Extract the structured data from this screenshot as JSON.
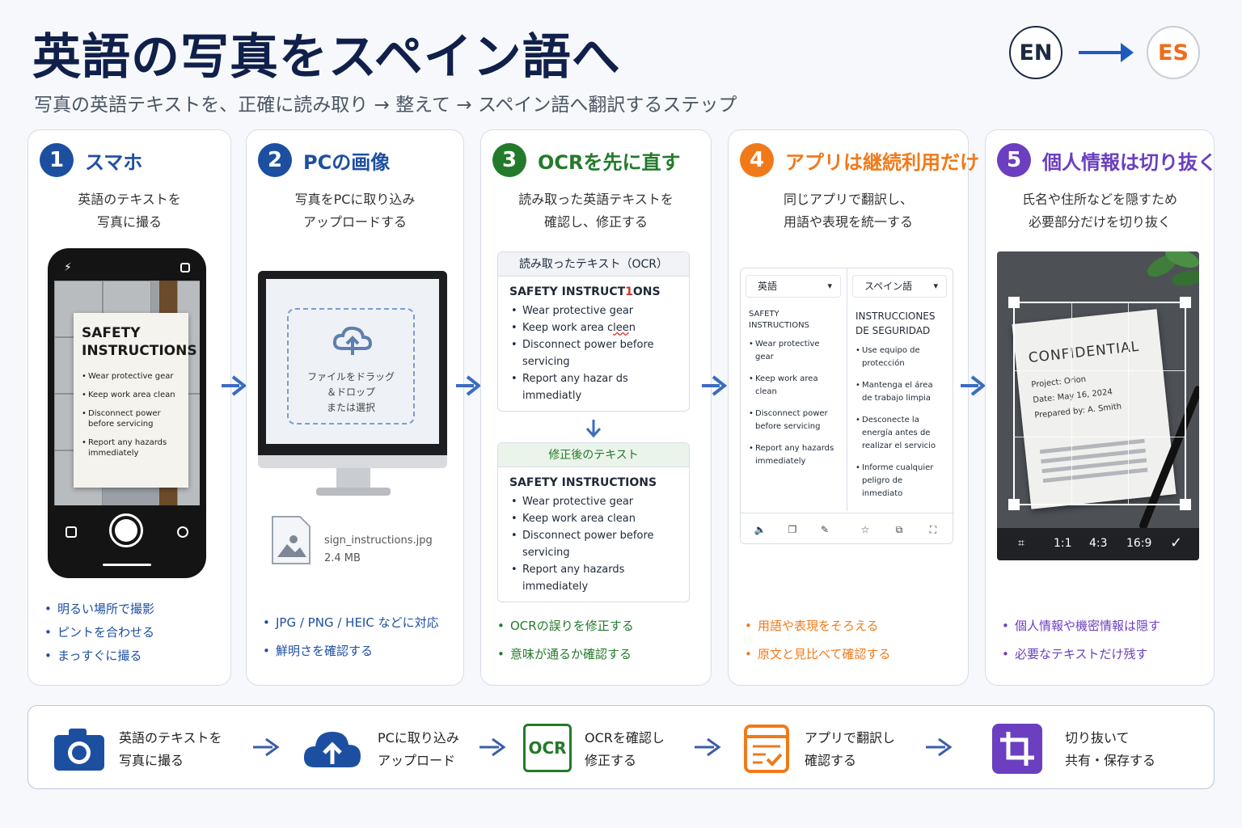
{
  "header": {
    "title": "英語の写真をスペイン語へ",
    "subtitle": "写真の英語テキストを、正確に読み取り → 整えて → スペイン語へ翻訳するステップ",
    "lang_from": "EN",
    "lang_to": "ES"
  },
  "colors": {
    "navy": "#10204a",
    "step1": "#1d4fa0",
    "step2": "#1d4fa0",
    "step3": "#237a2b",
    "step4": "#f07a1a",
    "step5": "#6b3fbf"
  },
  "steps": [
    {
      "num": "1",
      "title": "スマホ",
      "desc": [
        "英語のテキストを",
        "写真に撮る"
      ],
      "bullets": [
        "明るい場所で撮影",
        "ピントを合わせる",
        "まっすぐに撮る"
      ],
      "sign": {
        "title_1": "SAFETY",
        "title_2": "INSTRUCTIONS",
        "items": [
          "Wear protective gear",
          "Keep work area clean",
          "Disconnect power before servicing",
          "Report any hazards immediately"
        ]
      }
    },
    {
      "num": "2",
      "title": "PCの画像",
      "desc": [
        "写真をPCに取り込み",
        "アップロードする"
      ],
      "dropzone": [
        "ファイルをドラッグ",
        "＆ドロップ",
        "または選択"
      ],
      "file_name": "sign_instructions.jpg",
      "file_size": "2.4 MB",
      "bullets": [
        "JPG / PNG / HEIC などに対応",
        "鮮明さを確認する"
      ]
    },
    {
      "num": "3",
      "title": "OCRを先に直す",
      "desc": [
        "読み取った英語テキストを",
        "確認し、修正する"
      ],
      "ocr_raw": {
        "header": "読み取ったテキスト（OCR）",
        "title_a": "SAFETY INSTRUCT",
        "title_err": "1",
        "title_b": "ONS",
        "item1": "Wear protective gear",
        "item2_a": "Keep work area c",
        "item2_err": "lee",
        "item2_b": "n",
        "item3": "Disconnect power before servicing",
        "item4": "Report any hazar ds immediatly"
      },
      "ocr_fixed": {
        "header": "修正後のテキスト",
        "title": "SAFETY INSTRUCTIONS",
        "items": [
          "Wear protective gear",
          "Keep work area clean",
          "Disconnect power before servicing",
          "Report any hazards immediately"
        ]
      },
      "bullets": [
        "OCRの誤りを修正する",
        "意味が通るか確認する"
      ]
    },
    {
      "num": "4",
      "title": "アプリは継続利用だけ",
      "desc": [
        "同じアプリで翻訳し、",
        "用語や表現を統一する"
      ],
      "source_lang": "英語",
      "target_lang": "スペイン語",
      "source_title": "SAFETY INSTRUCTIONS",
      "source_items": [
        "Wear protective gear",
        "Keep work area clean",
        "Disconnect power before servicing",
        "Report any hazards immediately"
      ],
      "target_title_1": "INSTRUCCIONES",
      "target_title_2": "DE SEGURIDAD",
      "target_items": [
        "Use equipo de protección",
        "Mantenga el área de trabajo limpia",
        "Desconecte la energía antes de realizar el servicio",
        "Informe cualquier peligro de inmediato"
      ],
      "bullets": [
        "用語や表現をそろえる",
        "原文と見比べて確認する"
      ]
    },
    {
      "num": "5",
      "title": "個人情報は切り抜く",
      "desc": [
        "氏名や住所などを隠すため",
        "必要部分だけを切り抜く"
      ],
      "paper_title": "CONFIDENTIAL",
      "paper_lines": [
        "Project: Orion",
        "Date: May 16, 2024",
        "Prepared by: A. Smith"
      ],
      "ratios": [
        "1:1",
        "4:3",
        "16:9"
      ],
      "bullets": [
        "個人情報や機密情報は隠す",
        "必要なテキストだけ残す"
      ]
    }
  ],
  "flow": [
    {
      "icon": "camera-icon",
      "lines": [
        "英語のテキストを",
        "写真に撮る"
      ]
    },
    {
      "icon": "upload-cloud-icon",
      "lines": [
        "PCに取り込み",
        "アップロード"
      ]
    },
    {
      "icon": "ocr-icon",
      "label": "OCR",
      "lines": [
        "OCRを確認し",
        "修正する"
      ]
    },
    {
      "icon": "translate-doc-icon",
      "lines": [
        "アプリで翻訳し",
        "確認する"
      ]
    },
    {
      "icon": "crop-icon",
      "lines": [
        "切り抜いて",
        "共有・保存する"
      ]
    }
  ]
}
